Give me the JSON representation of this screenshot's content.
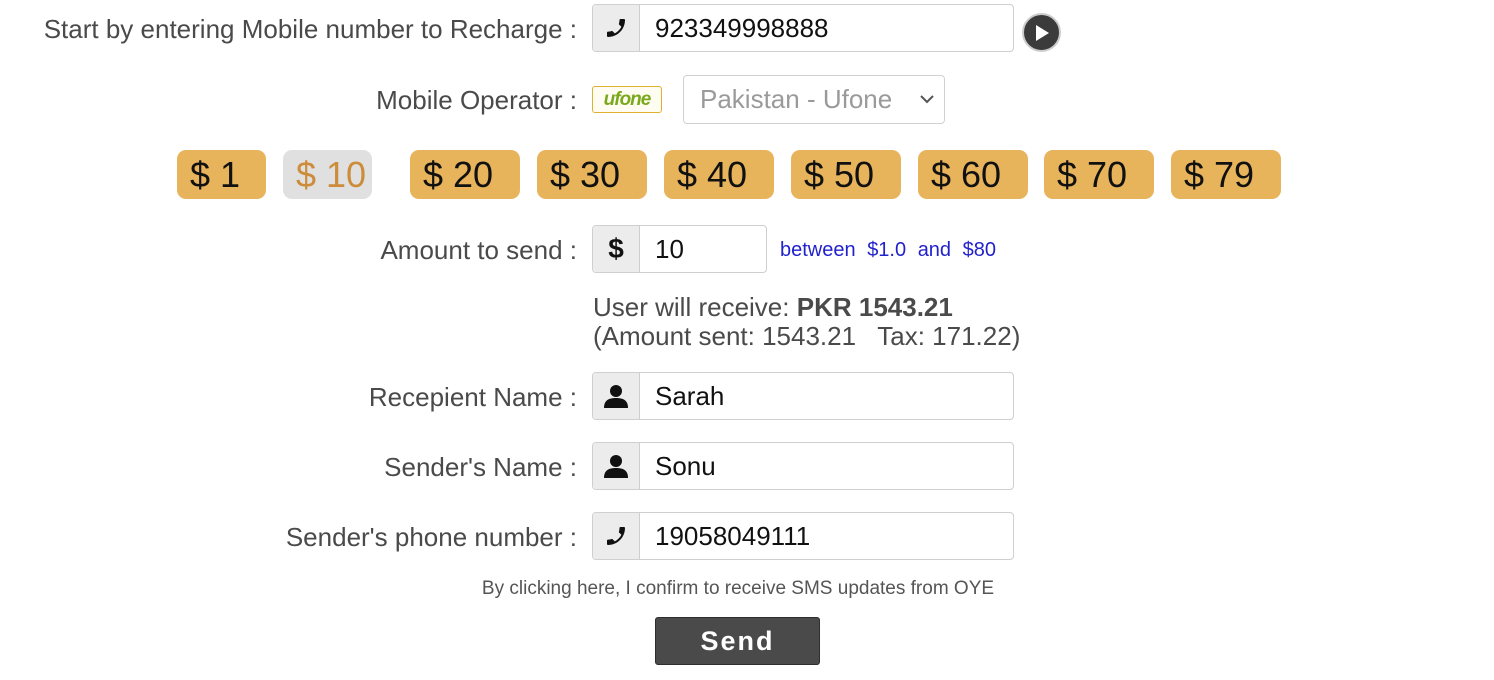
{
  "mobile": {
    "label": "Start by entering Mobile number to Recharge :",
    "value": "923349998888",
    "icon": "phone-icon",
    "go_icon": "play-circle-icon"
  },
  "operator": {
    "label": "Mobile Operator :",
    "logo_text": "ufone",
    "selected": "Pakistan - Ufone"
  },
  "amount_buttons": [
    "$ 1",
    "$ 10",
    "$ 20",
    "$ 30",
    "$ 40",
    "$ 50",
    "$ 60",
    "$ 70",
    "$ 79"
  ],
  "selected_amount_index": 1,
  "amount": {
    "label": "Amount to send :",
    "currency_icon": "dollar-icon",
    "value": "10",
    "range_prefix": "between",
    "range_min": "$1.0",
    "range_and": "and",
    "range_max": "$80"
  },
  "receive": {
    "prefix": "User will receive:",
    "value": "PKR 1543.21",
    "detail": "(Amount sent: 1543.21   Tax: 171.22)"
  },
  "recipient": {
    "label": "Recepient Name :",
    "value": "Sarah",
    "icon": "user-icon"
  },
  "sender": {
    "label": "Sender's Name :",
    "value": "Sonu",
    "icon": "user-icon"
  },
  "sender_phone": {
    "label": "Sender's phone number :",
    "value": "19058049111",
    "icon": "phone-icon"
  },
  "sms_notice": "By clicking here, I confirm to receive SMS updates from OYE",
  "send_label": "Send",
  "colors": {
    "amount_button": "#e7b35b",
    "amount_selected_bg": "#e0e0e0",
    "amount_selected_text": "#cc8c3a",
    "send_button": "#4a4a4a",
    "range_text": "#2222cc"
  }
}
